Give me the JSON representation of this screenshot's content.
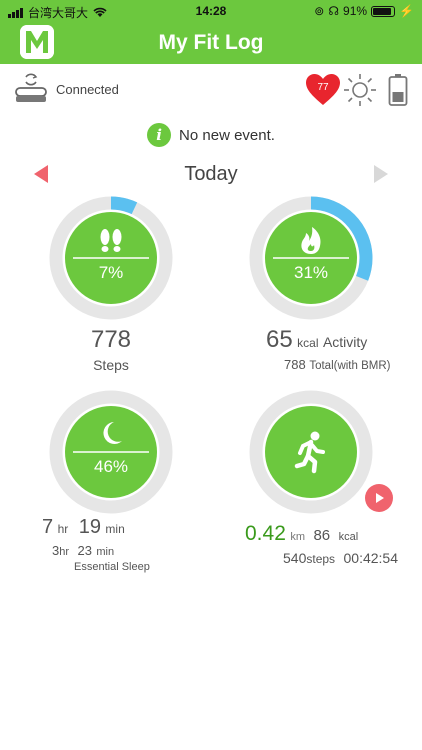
{
  "status": {
    "carrier": "台湾大哥大",
    "time": "14:28",
    "battery": "91%"
  },
  "app": {
    "title": "My Fit Log"
  },
  "device": {
    "status": "Connected",
    "heart_rate": "77"
  },
  "event": {
    "message": "No new event."
  },
  "date": {
    "label": "Today"
  },
  "steps": {
    "percent": "7%",
    "progress": 0.07,
    "value": "778",
    "label": "Steps"
  },
  "calories": {
    "percent": "31%",
    "progress": 0.31,
    "value": "65",
    "unit": "kcal",
    "label": "Activity",
    "total": "788",
    "total_label": "Total(with BMR)"
  },
  "sleep": {
    "percent": "46%",
    "hours": "7",
    "hr_unit": "hr",
    "minutes": "19",
    "min_unit": "min",
    "essential_hours": "3",
    "essential_minutes": "23",
    "essential_label": "Essential Sleep"
  },
  "workout": {
    "distance": "0.42",
    "distance_unit": "km",
    "kcal": "86",
    "kcal_unit": "kcal",
    "steps": "540",
    "steps_unit": "steps",
    "duration": "00:42:54"
  },
  "colors": {
    "green": "#6cc83e",
    "blue": "#5bc0f0",
    "red": "#f0636d",
    "ring": "#e6e6e6"
  }
}
